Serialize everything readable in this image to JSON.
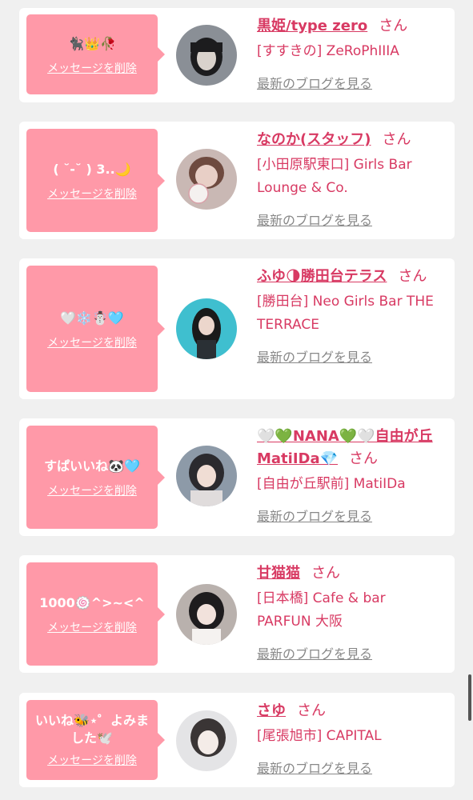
{
  "entries": [
    {
      "message": "🐈‍⬛👑🥀",
      "delete_label": "メッセージを削除",
      "name": "黒姫/type zero",
      "honorific": "さん",
      "shop": "[すすきの] ZeRoPhIIIA",
      "blog_label": "最新のブログを見る"
    },
    {
      "message": "( ˘-˘ ) 3..🌙",
      "delete_label": "メッセージを削除",
      "name": "なのか(スタッフ)",
      "honorific": "さん",
      "shop": "[小田原駅東口] Girls Bar Lounge & Co.",
      "blog_label": "最新のブログを見る"
    },
    {
      "message": "🤍❄️☃️🩵",
      "delete_label": "メッセージを削除",
      "name": "ふゆ🌗勝田台テラス",
      "honorific": "さん",
      "shop": "[勝田台] Neo Girls Bar THE TERRACE",
      "blog_label": "最新のブログを見る"
    },
    {
      "message": "すぱいいね🐼🩵",
      "delete_label": "メッセージを削除",
      "name": "🤍💚NANA💚🤍自由が丘MatiIDa💎",
      "honorific": "さん",
      "shop": "[自由が丘駅前] MatiIDa",
      "blog_label": "最新のブログを見る"
    },
    {
      "message": "1000🍥^>~<^",
      "delete_label": "メッセージを削除",
      "name": "甘猫猫",
      "honorific": "さん",
      "shop": "[日本橋] Cafe & bar PARFUN 大阪",
      "blog_label": "最新のブログを見る"
    },
    {
      "message": "いいね🐝⋆゜よみました🕊️",
      "delete_label": "メッセージを削除",
      "name": "さゆ",
      "honorific": "さん",
      "shop": "[尾張旭市] CAPITAL",
      "blog_label": "最新のブログを見る"
    }
  ],
  "colors": {
    "accent": "#d83a63",
    "bubble": "#ff99a8",
    "background": "#f0f0f0"
  }
}
